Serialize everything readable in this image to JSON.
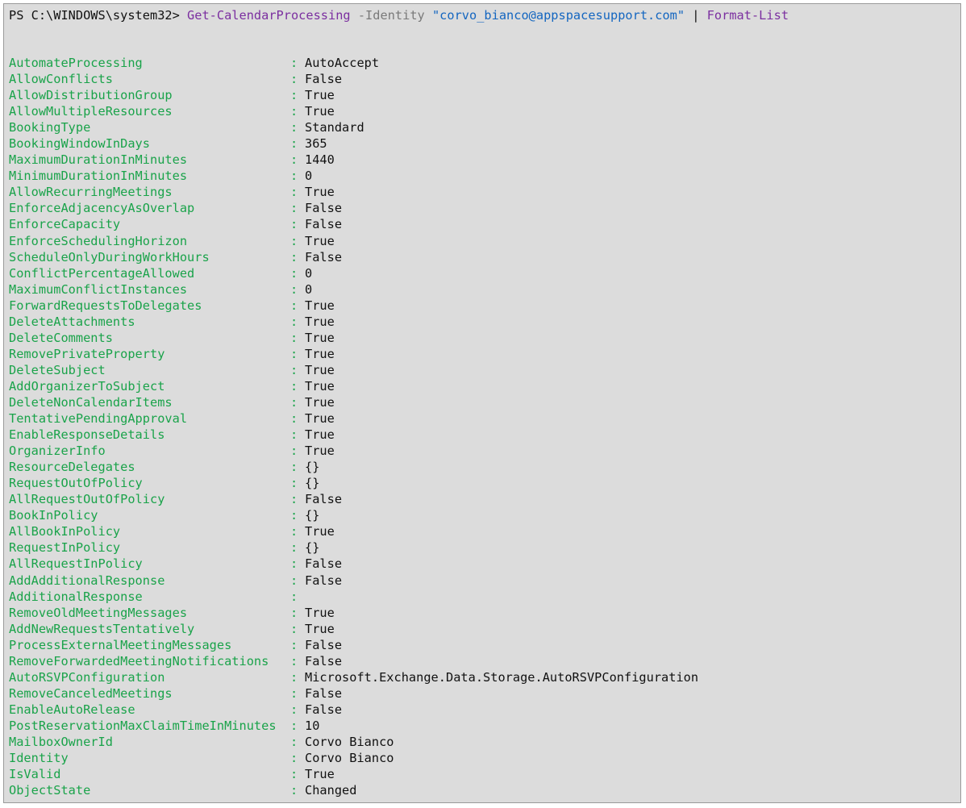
{
  "window": {
    "background": "#dcdcdc"
  },
  "prompt": {
    "prefix": "PS C:\\WINDOWS\\system32> ",
    "command": "Get-CalendarProcessing",
    "parameter": " -Identity ",
    "argument": "\"corvo_bianco@appspacesupport.com\"",
    "pipe": " | ",
    "pipe_command": "Format-List"
  },
  "colors": {
    "property_name": "#1aa34a",
    "cmdlet": "#7b2fa0",
    "string": "#1466c0",
    "parameter": "#7a7a7a"
  },
  "separator": ":",
  "properties": [
    {
      "name": "AutomateProcessing",
      "value": "AutoAccept"
    },
    {
      "name": "AllowConflicts",
      "value": "False"
    },
    {
      "name": "AllowDistributionGroup",
      "value": "True"
    },
    {
      "name": "AllowMultipleResources",
      "value": "True"
    },
    {
      "name": "BookingType",
      "value": "Standard"
    },
    {
      "name": "BookingWindowInDays",
      "value": "365"
    },
    {
      "name": "MaximumDurationInMinutes",
      "value": "1440"
    },
    {
      "name": "MinimumDurationInMinutes",
      "value": "0"
    },
    {
      "name": "AllowRecurringMeetings",
      "value": "True"
    },
    {
      "name": "EnforceAdjacencyAsOverlap",
      "value": "False"
    },
    {
      "name": "EnforceCapacity",
      "value": "False"
    },
    {
      "name": "EnforceSchedulingHorizon",
      "value": "True"
    },
    {
      "name": "ScheduleOnlyDuringWorkHours",
      "value": "False"
    },
    {
      "name": "ConflictPercentageAllowed",
      "value": "0"
    },
    {
      "name": "MaximumConflictInstances",
      "value": "0"
    },
    {
      "name": "ForwardRequestsToDelegates",
      "value": "True"
    },
    {
      "name": "DeleteAttachments",
      "value": "True"
    },
    {
      "name": "DeleteComments",
      "value": "True"
    },
    {
      "name": "RemovePrivateProperty",
      "value": "True"
    },
    {
      "name": "DeleteSubject",
      "value": "True"
    },
    {
      "name": "AddOrganizerToSubject",
      "value": "True"
    },
    {
      "name": "DeleteNonCalendarItems",
      "value": "True"
    },
    {
      "name": "TentativePendingApproval",
      "value": "True"
    },
    {
      "name": "EnableResponseDetails",
      "value": "True"
    },
    {
      "name": "OrganizerInfo",
      "value": "True"
    },
    {
      "name": "ResourceDelegates",
      "value": "{}"
    },
    {
      "name": "RequestOutOfPolicy",
      "value": "{}"
    },
    {
      "name": "AllRequestOutOfPolicy",
      "value": "False"
    },
    {
      "name": "BookInPolicy",
      "value": "{}"
    },
    {
      "name": "AllBookInPolicy",
      "value": "True"
    },
    {
      "name": "RequestInPolicy",
      "value": "{}"
    },
    {
      "name": "AllRequestInPolicy",
      "value": "False"
    },
    {
      "name": "AddAdditionalResponse",
      "value": "False"
    },
    {
      "name": "AdditionalResponse",
      "value": ""
    },
    {
      "name": "RemoveOldMeetingMessages",
      "value": "True"
    },
    {
      "name": "AddNewRequestsTentatively",
      "value": "True"
    },
    {
      "name": "ProcessExternalMeetingMessages",
      "value": "False"
    },
    {
      "name": "RemoveForwardedMeetingNotifications",
      "value": "False"
    },
    {
      "name": "AutoRSVPConfiguration",
      "value": "Microsoft.Exchange.Data.Storage.AutoRSVPConfiguration"
    },
    {
      "name": "RemoveCanceledMeetings",
      "value": "False"
    },
    {
      "name": "EnableAutoRelease",
      "value": "False"
    },
    {
      "name": "PostReservationMaxClaimTimeInMinutes",
      "value": "10"
    },
    {
      "name": "MailboxOwnerId",
      "value": "Corvo Bianco"
    },
    {
      "name": "Identity",
      "value": "Corvo Bianco"
    },
    {
      "name": "IsValid",
      "value": "True"
    },
    {
      "name": "ObjectState",
      "value": "Changed"
    }
  ]
}
